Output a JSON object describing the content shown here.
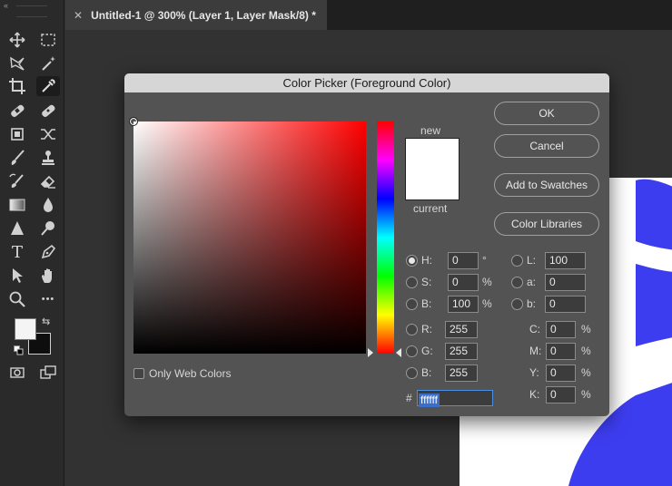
{
  "toolbar": {
    "collapse_glyph": "«",
    "tools": [
      {
        "name": "move-tool",
        "icon": "move-icon"
      },
      {
        "name": "marquee-tool",
        "icon": "rect-marquee-icon"
      },
      {
        "name": "lasso-tool",
        "icon": "lasso-icon"
      },
      {
        "name": "magic-wand-tool",
        "icon": "magic-wand-icon"
      },
      {
        "name": "crop-tool",
        "icon": "crop-icon"
      },
      {
        "name": "eyedropper-tool",
        "icon": "eyedropper-icon",
        "active": true
      },
      {
        "name": "healing-tool",
        "icon": "bandage-icon"
      },
      {
        "name": "patch-tool",
        "icon": "patch-icon"
      },
      {
        "name": "content-aware-tool",
        "icon": "content-aware-icon"
      },
      {
        "name": "brush-tool",
        "icon": "brush-icon"
      },
      {
        "name": "stamp-tool",
        "icon": "stamp-icon"
      },
      {
        "name": "history-brush-tool",
        "icon": "history-brush-icon"
      },
      {
        "name": "eraser-tool",
        "icon": "eraser-icon"
      },
      {
        "name": "gradient-tool",
        "icon": "gradient-icon"
      },
      {
        "name": "blur-tool",
        "icon": "drop-icon"
      },
      {
        "name": "sharpen-tool",
        "icon": "triangle-icon"
      },
      {
        "name": "dodge-tool",
        "icon": "dodge-icon"
      },
      {
        "name": "type-tool",
        "icon": "type-icon"
      },
      {
        "name": "pen-tool",
        "icon": "pen-icon"
      },
      {
        "name": "path-select-tool",
        "icon": "arrow-icon"
      },
      {
        "name": "hand-tool",
        "icon": "hand-icon"
      },
      {
        "name": "zoom-tool",
        "icon": "zoom-icon"
      },
      {
        "name": "more-tools",
        "icon": "more-icon"
      }
    ],
    "type_glyph": "T",
    "more_glyph": "•••",
    "swap_glyph": "⇆",
    "foreground_color": "#f4f4f4",
    "background_color": "#0e0e0e"
  },
  "tab": {
    "close_glyph": "✕",
    "title": "Untitled-1 @ 300% (Layer 1, Layer Mask/8) *"
  },
  "dialog": {
    "title": "Color Picker (Foreground Color)",
    "new_label": "new",
    "current_label": "current",
    "new_color": "#ffffff",
    "buttons": {
      "ok": "OK",
      "cancel": "Cancel",
      "add_swatches": "Add to Swatches",
      "color_libraries": "Color Libraries"
    },
    "hsb": {
      "h_label": "H:",
      "h_value": "0",
      "h_unit": "°",
      "s_label": "S:",
      "s_value": "0",
      "s_unit": "%",
      "b_label": "B:",
      "b_value": "100",
      "b_unit": "%"
    },
    "rgb": {
      "r_label": "R:",
      "r_value": "255",
      "g_label": "G:",
      "g_value": "255",
      "b_label": "B:",
      "b_value": "255"
    },
    "lab": {
      "l_label": "L:",
      "l_value": "100",
      "a_label": "a:",
      "a_value": "0",
      "b_label": "b:",
      "b_value": "0"
    },
    "cmyk": {
      "c_label": "C:",
      "c_value": "0",
      "c_unit": "%",
      "m_label": "M:",
      "m_value": "0",
      "m_unit": "%",
      "y_label": "Y:",
      "y_value": "0",
      "y_unit": "%",
      "k_label": "K:",
      "k_value": "0",
      "k_unit": "%"
    },
    "only_web_colors_label": "Only Web Colors",
    "only_web_colors_checked": false,
    "hex_label": "#",
    "hex_value": "ffffff",
    "selected_model": "H"
  },
  "canvas": {
    "art_color": "#3d3df0"
  }
}
